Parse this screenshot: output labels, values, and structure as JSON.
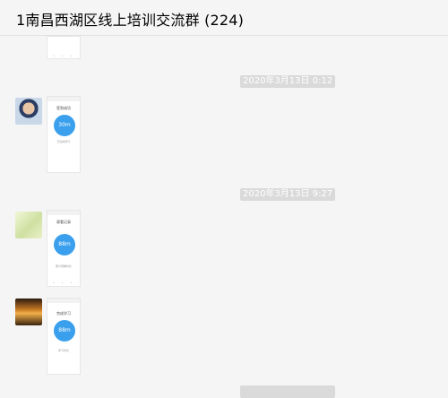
{
  "header": {
    "title": "1南昌西湖区线上培训交流群 (224)"
  },
  "timestamps": [
    "2020年3月13日 0:12",
    "2020年3月13日 9:27"
  ],
  "messages": [
    {
      "phone_title": "签到成功",
      "circle_text": "30m",
      "caption": "已完成学习"
    },
    {
      "phone_title": "观看记录",
      "circle_text": "88m",
      "caption": "累计观看时长"
    },
    {
      "phone_title": "完成学习",
      "circle_text": "88m",
      "caption": "学习时长"
    }
  ],
  "colors": {
    "background": "#f5f5f5",
    "timestamp_bg": "#dadada",
    "accent_circle": "#3aa0ee"
  }
}
